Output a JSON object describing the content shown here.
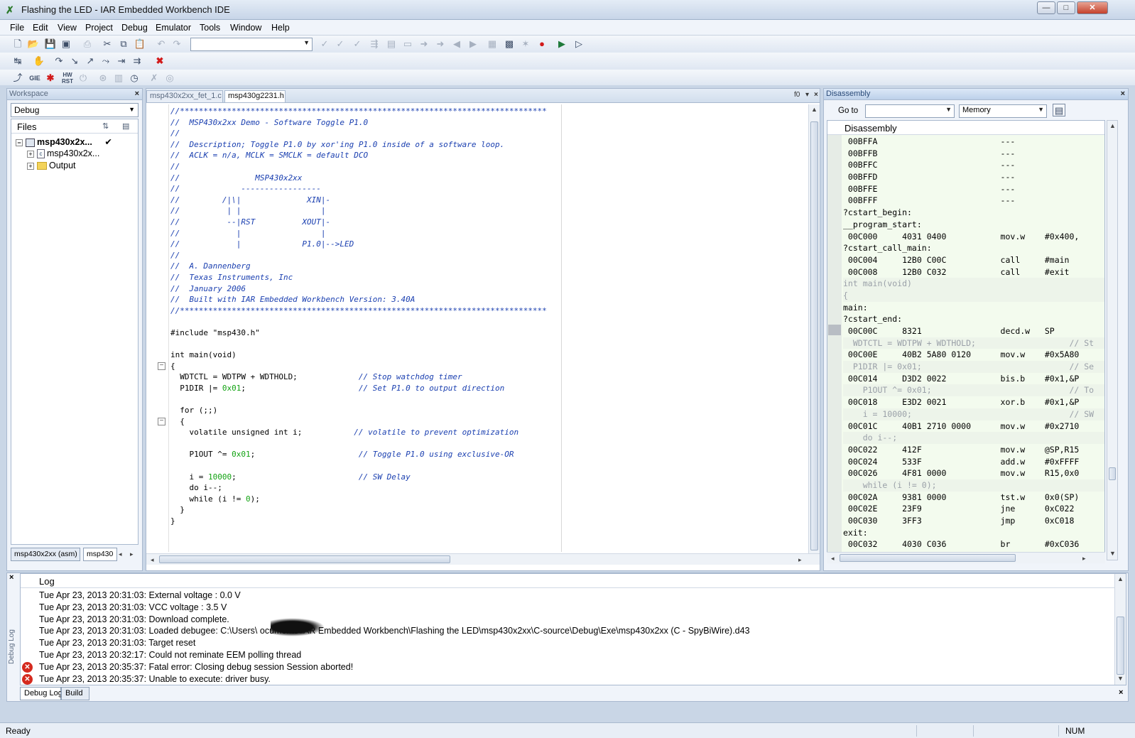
{
  "window": {
    "title": "Flashing the LED - IAR Embedded Workbench IDE",
    "min_label": "—",
    "max_label": "□",
    "close_label": "✕"
  },
  "menu": [
    "File",
    "Edit",
    "View",
    "Project",
    "Debug",
    "Emulator",
    "Tools",
    "Window",
    "Help"
  ],
  "toolbar": {
    "find_combo_value": "",
    "debug_labels": [
      "GIE",
      "HW RST"
    ]
  },
  "workspace": {
    "title": "Workspace",
    "config": "Debug",
    "files_header": "Files",
    "tree": [
      {
        "label": "msp430x2x...",
        "check": "✔"
      },
      {
        "label": "msp430x2x..."
      },
      {
        "label": "Output"
      }
    ],
    "tabs": [
      "msp430x2xx (asm)",
      "msp430"
    ]
  },
  "editor": {
    "tabs": [
      "msp430x2xx_fet_1.c",
      "msp430g2231.h"
    ],
    "tab_controls": "f0",
    "lines": [
      [
        [
          "c",
          "//******************************************************************************"
        ]
      ],
      [
        [
          "c",
          "//  MSP430x2xx Demo - Software Toggle P1.0"
        ]
      ],
      [
        [
          "c",
          "//"
        ]
      ],
      [
        [
          "c",
          "//  Description; Toggle P1.0 by xor'ing P1.0 inside of a software loop."
        ]
      ],
      [
        [
          "c",
          "//  ACLK = n/a, MCLK = SMCLK = default DCO"
        ]
      ],
      [
        [
          "c",
          "//"
        ]
      ],
      [
        [
          "c",
          "//                MSP430x2xx"
        ]
      ],
      [
        [
          "c",
          "//             -----------------"
        ]
      ],
      [
        [
          "c",
          "//         /|\\|              XIN|-"
        ]
      ],
      [
        [
          "c",
          "//          | |                 |"
        ]
      ],
      [
        [
          "c",
          "//          --|RST          XOUT|-"
        ]
      ],
      [
        [
          "c",
          "//            |                 |"
        ]
      ],
      [
        [
          "c",
          "//            |             P1.0|-->LED"
        ]
      ],
      [
        [
          "c",
          "//"
        ]
      ],
      [
        [
          "c",
          "//  A. Dannenberg"
        ]
      ],
      [
        [
          "c",
          "//  Texas Instruments, Inc"
        ]
      ],
      [
        [
          "c",
          "//  January 2006"
        ]
      ],
      [
        [
          "c",
          "//  Built with IAR Embedded Workbench Version: 3.40A"
        ]
      ],
      [
        [
          "c",
          "//******************************************************************************"
        ]
      ],
      [
        [
          "p",
          ""
        ]
      ],
      [
        [
          "p",
          "#include \"msp430.h\""
        ]
      ],
      [
        [
          "p",
          ""
        ]
      ],
      [
        [
          "p",
          "int main(void)"
        ]
      ],
      [
        [
          "p",
          "{"
        ]
      ],
      [
        [
          "p",
          "  WDTCTL = WDTPW + WDTHOLD;             "
        ],
        [
          "c",
          "// Stop watchdog timer"
        ]
      ],
      [
        [
          "p",
          "  P1DIR |= "
        ],
        [
          "n",
          "0x01"
        ],
        [
          "p",
          ";                        "
        ],
        [
          "c",
          "// Set P1.0 to output direction"
        ]
      ],
      [
        [
          "p",
          ""
        ]
      ],
      [
        [
          "p",
          "  for (;;)"
        ]
      ],
      [
        [
          "p",
          "  {"
        ]
      ],
      [
        [
          "p",
          "    volatile unsigned int i;           "
        ],
        [
          "c",
          "// volatile to prevent optimization"
        ]
      ],
      [
        [
          "p",
          ""
        ]
      ],
      [
        [
          "p",
          "    P1OUT ^= "
        ],
        [
          "n",
          "0x01"
        ],
        [
          "p",
          ";                      "
        ],
        [
          "c",
          "// Toggle P1.0 using exclusive-OR"
        ]
      ],
      [
        [
          "p",
          ""
        ]
      ],
      [
        [
          "p",
          "    i = "
        ],
        [
          "n",
          "10000"
        ],
        [
          "p",
          ";                          "
        ],
        [
          "c",
          "// SW Delay"
        ]
      ],
      [
        [
          "p",
          "    do i--;"
        ]
      ],
      [
        [
          "p",
          "    while (i != "
        ],
        [
          "n",
          "0"
        ],
        [
          "p",
          ");"
        ]
      ],
      [
        [
          "p",
          "  }"
        ]
      ],
      [
        [
          "p",
          "}"
        ]
      ]
    ]
  },
  "disassembly": {
    "title": "Disassembly",
    "goto_label": "Go to",
    "goto_value": "",
    "memory_combo": "Memory",
    "header": "Disassembly",
    "rows": [
      {
        "t": "asm",
        "text": "00BFFA                         ---"
      },
      {
        "t": "asm",
        "text": "00BFFB                         ---"
      },
      {
        "t": "asm",
        "text": "00BFFC                         ---"
      },
      {
        "t": "asm",
        "text": "00BFFD                         ---"
      },
      {
        "t": "asm",
        "text": "00BFFE                         ---"
      },
      {
        "t": "asm",
        "text": "00BFFF                         ---"
      },
      {
        "t": "label",
        "text": "?cstart_begin:"
      },
      {
        "t": "label",
        "text": "__program_start:"
      },
      {
        "t": "asm",
        "text": "00C000     4031 0400           mov.w    #0x400,"
      },
      {
        "t": "label",
        "text": "?cstart_call_main:"
      },
      {
        "t": "asm",
        "text": "00C004     12B0 C00C           call     #main"
      },
      {
        "t": "asm",
        "text": "00C008     12B0 C032           call     #exit"
      },
      {
        "t": "src",
        "text": "int main(void)"
      },
      {
        "t": "src",
        "text": "{"
      },
      {
        "t": "label",
        "text": "main:"
      },
      {
        "t": "label",
        "text": "?cstart_end:"
      },
      {
        "t": "asm",
        "text": "00C00C     8321                decd.w   SP"
      },
      {
        "t": "src",
        "text": "  WDTCTL = WDTPW + WDTHOLD;                   // St"
      },
      {
        "t": "asm",
        "text": "00C00E     40B2 5A80 0120      mov.w    #0x5A80"
      },
      {
        "t": "src",
        "text": "  P1DIR |= 0x01;                              // Se"
      },
      {
        "t": "asm",
        "text": "00C014     D3D2 0022           bis.b    #0x1,&P"
      },
      {
        "t": "src",
        "text": "    P1OUT ^= 0x01;                            // To"
      },
      {
        "t": "asm",
        "text": "00C018     E3D2 0021           xor.b    #0x1,&P"
      },
      {
        "t": "src",
        "text": "    i = 10000;                                // SW"
      },
      {
        "t": "asm",
        "text": "00C01C     40B1 2710 0000      mov.w    #0x2710"
      },
      {
        "t": "src",
        "text": "    do i--;"
      },
      {
        "t": "asm",
        "text": "00C022     412F                mov.w    @SP,R15"
      },
      {
        "t": "asm",
        "text": "00C024     533F                add.w    #0xFFFF"
      },
      {
        "t": "asm",
        "text": "00C026     4F81 0000           mov.w    R15,0x0"
      },
      {
        "t": "src",
        "text": "    while (i != 0);"
      },
      {
        "t": "asm",
        "text": "00C02A     9381 0000           tst.w    0x0(SP)"
      },
      {
        "t": "asm",
        "text": "00C02E     23F9                jne      0xC022"
      },
      {
        "t": "asm",
        "text": "00C030     3FF3                jmp      0xC018"
      },
      {
        "t": "label",
        "text": "exit:"
      },
      {
        "t": "asm",
        "text": "00C032     4030 C036           br       #0xC036"
      }
    ]
  },
  "log": {
    "side_label": "Debug Log",
    "header": "Log",
    "lines": [
      {
        "text": "Tue Apr 23, 2013 20:31:03: External voltage : 0.0 V",
        "error": false
      },
      {
        "text": "Tue Apr 23, 2013 20:31:03: VCC voltage : 3.5 V",
        "error": false
      },
      {
        "text": "Tue Apr 23, 2013 20:31:03: Download complete.",
        "error": false
      },
      {
        "text": "Tue Apr 23, 2013 20:31:03: Loaded debugee: C:\\Users\\          ocuments\\IAR Embedded Workbench\\Flashing the LED\\msp430x2xx\\C-source\\Debug\\Exe\\msp430x2xx (C - SpyBiWire).d43",
        "error": false
      },
      {
        "text": "Tue Apr 23, 2013 20:31:03: Target reset",
        "error": false
      },
      {
        "text": "Tue Apr 23, 2013 20:32:17: Could not reminate EEM polling thread",
        "error": false
      },
      {
        "text": "Tue Apr 23, 2013 20:35:37: Fatal error: Closing debug session   Session aborted!",
        "error": true
      },
      {
        "text": "Tue Apr 23, 2013 20:35:37: Unable to execute: driver busy.",
        "error": true
      }
    ],
    "tabs": [
      "Debug Log",
      "Build"
    ]
  },
  "status": {
    "text": "Ready",
    "num": "NUM"
  }
}
